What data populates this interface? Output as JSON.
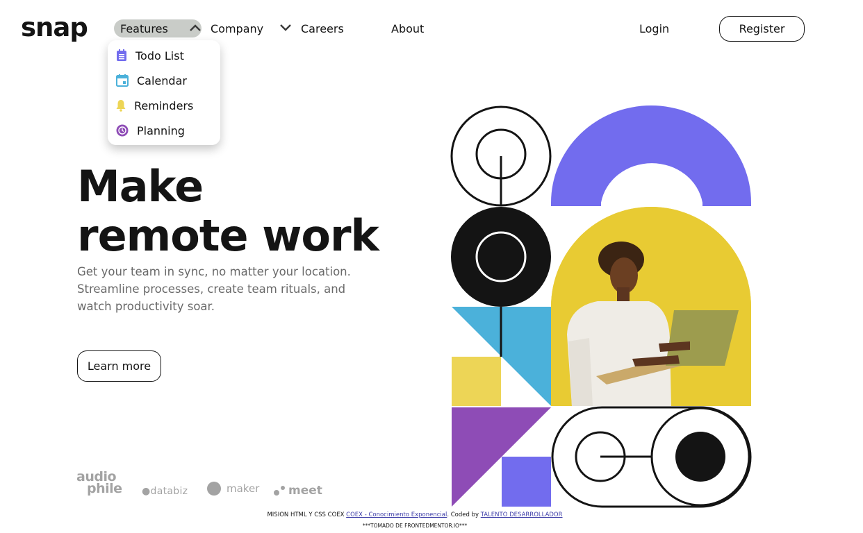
{
  "header": {
    "logo": "snap",
    "nav": {
      "features": "Features",
      "company": "Company",
      "careers": "Careers",
      "about": "About",
      "login": "Login",
      "register": "Register"
    }
  },
  "dropdown": {
    "items": [
      {
        "label": "Todo List",
        "icon": "todo-list-icon",
        "color": "#726CEE"
      },
      {
        "label": "Calendar",
        "icon": "calendar-icon",
        "color": "#4BB1DA"
      },
      {
        "label": "Reminders",
        "icon": "bell-icon",
        "color": "#EDD556"
      },
      {
        "label": "Planning",
        "icon": "planning-clock-icon",
        "color": "#8E4CB6"
      }
    ]
  },
  "hero": {
    "title_line1": "Make",
    "title_line2": "remote work",
    "description": "Get your team in sync, no matter your location. Streamline processes, create team rituals, and watch productivity soar.",
    "cta": "Learn more"
  },
  "clients": {
    "audiophile_line1": "audio",
    "audiophile_line2": "phile",
    "databiz": "databiz",
    "maker": "maker",
    "meet": "meet"
  },
  "footer": {
    "prefix": "MISION HTML Y CSS COEX",
    "link1": "COEX - Conocimiento Exponencial",
    "coded_by": ". Coded by",
    "link2": "TALENTO DESARROLLADOR",
    "line2": "***TOMADO DE FRONTEDMENTOR.IO***"
  },
  "colors": {
    "accent_purple": "#726CEE",
    "blue": "#4BB1DA",
    "yellow": "#EDD556",
    "violet": "#8E4CB6",
    "dark": "#141414"
  }
}
